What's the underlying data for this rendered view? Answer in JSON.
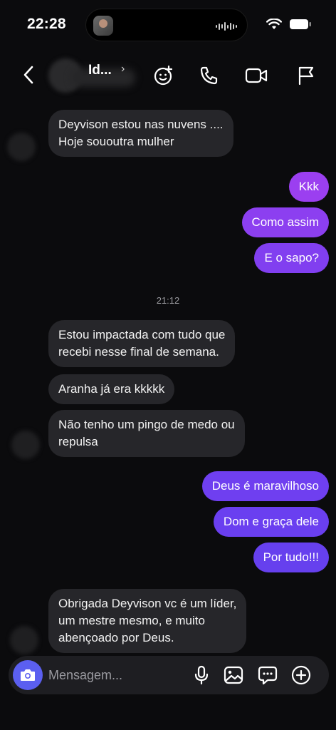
{
  "status_bar": {
    "time": "22:28"
  },
  "header": {
    "name": "Id...",
    "chevron": "›",
    "icons": [
      "sticker-smile-icon",
      "phone-icon",
      "video-icon",
      "flag-icon"
    ]
  },
  "messages": [
    {
      "side": "in",
      "text": "Deyvison estou nas nuvens ....\nHoje sououtra mulher"
    },
    {
      "side": "out",
      "text": "Kkk"
    },
    {
      "side": "out",
      "text": "Como assim"
    },
    {
      "side": "out",
      "text": "E o sapo?"
    },
    {
      "timestamp": "21:12"
    },
    {
      "side": "in",
      "text": "Estou impactada com tudo que\nrecebi nesse final de semana."
    },
    {
      "side": "in",
      "text": "Aranha já era kkkkk"
    },
    {
      "side": "in",
      "text": "Não tenho um pingo de medo ou\nrepulsa"
    },
    {
      "side": "out",
      "text": "Deus é maravilhoso"
    },
    {
      "side": "out",
      "text": "Dom e graça dele"
    },
    {
      "side": "out",
      "text": "Por tudo!!!"
    },
    {
      "side": "in",
      "text": "Obrigada Deyvison vc é um líder,\num mestre mesmo, e muito\nabençoado por Deus."
    }
  ],
  "composer": {
    "placeholder": "Mensagem..."
  },
  "colors": {
    "incoming": "#26262a",
    "outgoing_top": "#8a3ff0",
    "outgoing_bottom": "#6a3ff0",
    "camera": "#5b5ff0"
  }
}
